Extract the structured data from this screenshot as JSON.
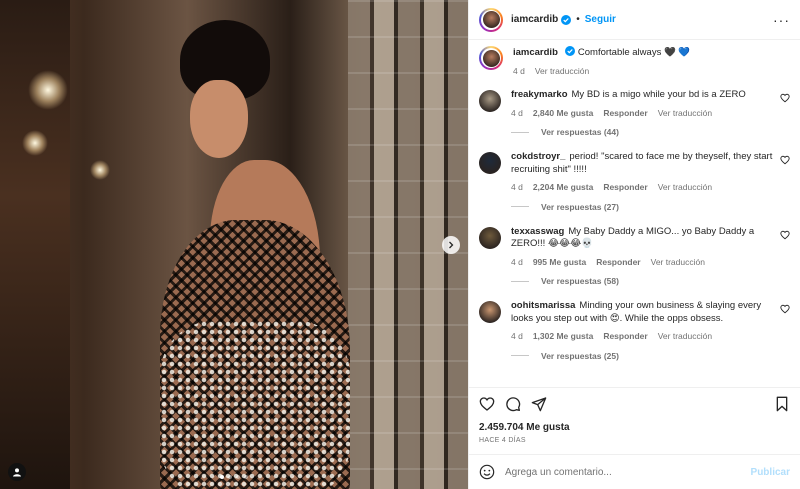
{
  "post": {
    "author": "iamcardib",
    "follow_label": "Seguir",
    "dot": "•",
    "more_label": "···",
    "caption_text": "Comfortable always 🖤 💙",
    "caption_time": "4 d",
    "translation_label": "Ver traducción",
    "carousel": {
      "total": 4,
      "active": 0
    }
  },
  "comments": [
    {
      "user": "freakymarko",
      "text": "My BD is a migo while your bd is a ZERO",
      "time": "4 d",
      "likes": "2,840 Me gusta",
      "reply": "Responder",
      "translate": "Ver traducción",
      "replies": "Ver respuestas (44)",
      "avatar_color": "#a89a86"
    },
    {
      "user": "cokdstroyr_",
      "text": "period! \"scared to face me by theyself, they start recruiting shit\" !!!!!",
      "time": "4 d",
      "likes": "2,204 Me gusta",
      "reply": "Responder",
      "translate": "Ver traducción",
      "replies": "Ver respuestas (27)",
      "avatar_color": "#1f2a3a"
    },
    {
      "user": "texxasswag",
      "text": "My Baby Daddy a MIGO... yo Baby Daddy a ZERO!!! 😂😂😂💀",
      "time": "4 d",
      "likes": "995 Me gusta",
      "reply": "Responder",
      "translate": "Ver traducción",
      "replies": "Ver respuestas (58)",
      "avatar_color": "#6e5a3c"
    },
    {
      "user": "oohitsmarissa",
      "text": "Minding your own business & slaying every looks you step out with 😍. While the opps obsess.",
      "time": "4 d",
      "likes": "1,302 Me gusta",
      "reply": "Responder",
      "translate": "Ver traducción",
      "replies": "Ver respuestas (25)",
      "avatar_color": "#c99670"
    }
  ],
  "footer": {
    "likes": "2.459.704 Me gusta",
    "timestamp": "HACE 4 DÍAS",
    "comment_placeholder": "Agrega un comentario...",
    "publish_label": "Publicar"
  },
  "icons": {
    "verified": "verified-badge-icon",
    "like": "heart-icon",
    "comment": "comment-icon",
    "share": "share-icon",
    "save": "bookmark-icon",
    "emoji": "emoji-icon",
    "next": "chevron-right-icon",
    "tag": "user-tag-icon"
  },
  "colors": {
    "accent": "#0095f6",
    "muted": "#737373",
    "verified": "#0095f6",
    "publish_disabled": "#b2dffc"
  }
}
